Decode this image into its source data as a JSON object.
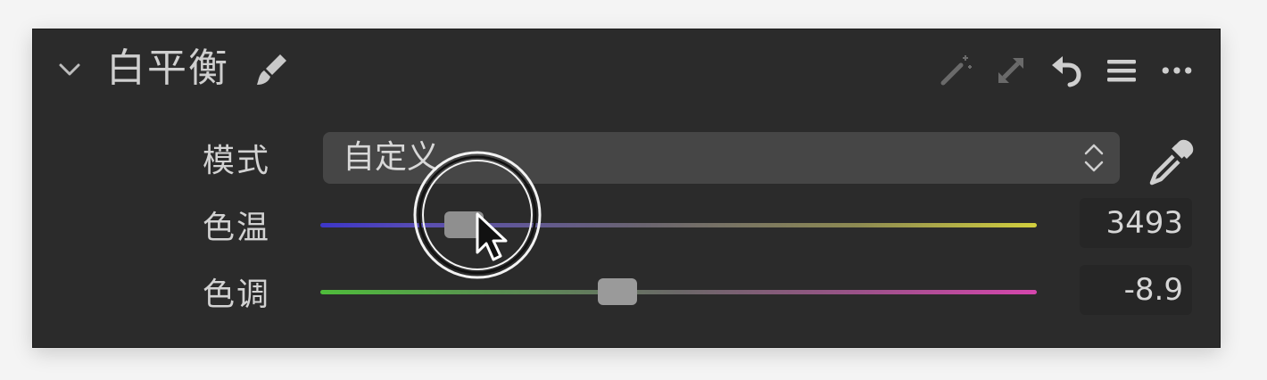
{
  "panel": {
    "title": "白平衡",
    "icons": {
      "collapse": "chevron-down-icon",
      "brush": "brush-icon",
      "auto": "magic-wand-icon",
      "expand": "expand-icon",
      "reset": "undo-icon",
      "presets": "list-icon",
      "more": "more-icon"
    }
  },
  "mode": {
    "label": "模式",
    "value": "自定义"
  },
  "temperature": {
    "label": "色温",
    "value": "3493",
    "slider_fraction": 0.2
  },
  "tint": {
    "label": "色调",
    "value": "-8.9",
    "slider_fraction": 0.415
  },
  "colors": {
    "panel_bg": "#2b2b2b",
    "text": "#d2d2d2",
    "temp_start": "#3d36c8",
    "temp_end": "#d2cf3e",
    "tint_start": "#4fbc3b",
    "tint_end": "#d546ad"
  }
}
